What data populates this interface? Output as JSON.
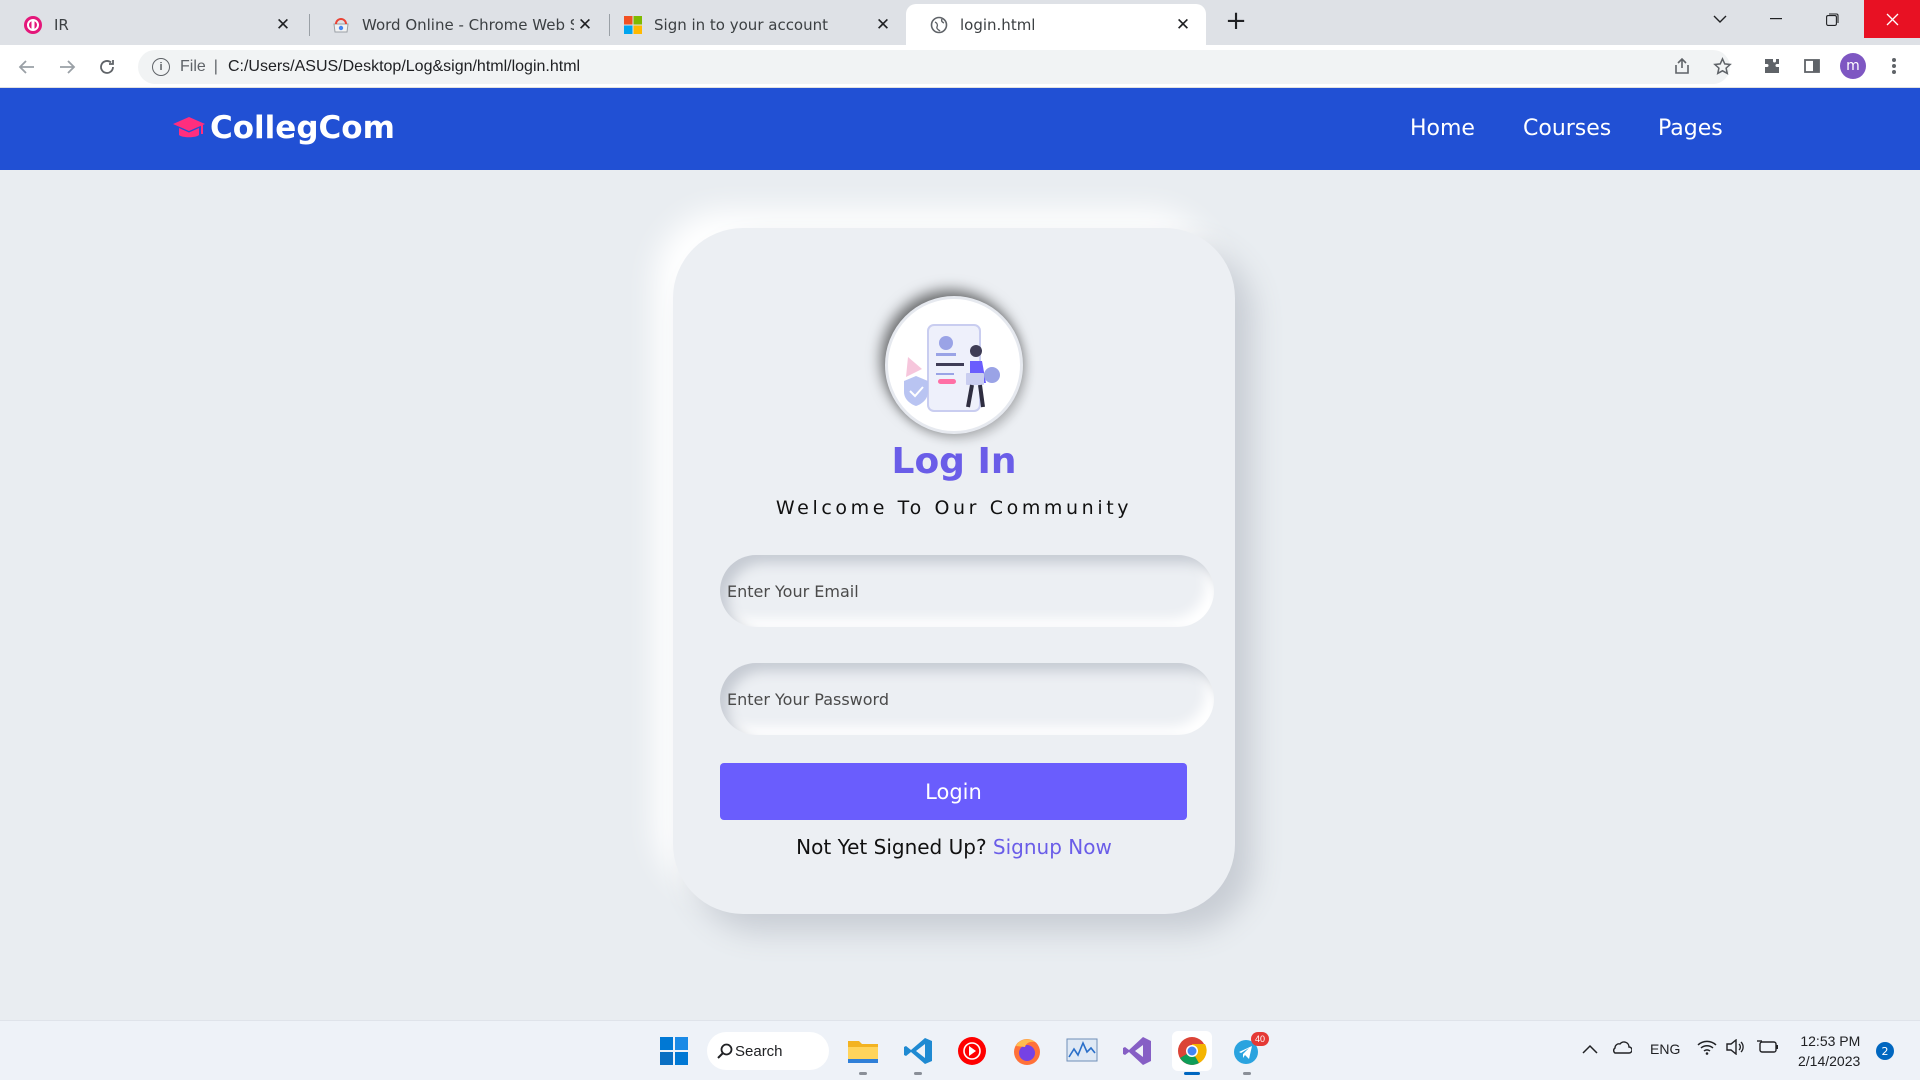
{
  "browser": {
    "tabs": [
      {
        "title": "IR",
        "icon": "ir-app-icon"
      },
      {
        "title": "Word Online - Chrome Web Store",
        "icon": "chrome-web-store-icon"
      },
      {
        "title": "Sign in to your account",
        "icon": "microsoft-logo-icon"
      },
      {
        "title": "login.html",
        "icon": "globe-icon",
        "active": true
      }
    ],
    "address": {
      "scheme_label": "File",
      "url": "C:/Users/ASUS/Desktop/Log&sign/html/login.html"
    },
    "profile_initial": "m"
  },
  "site": {
    "brand": "CollegCom",
    "nav": [
      "Home",
      "Courses",
      "Pages"
    ],
    "colors": {
      "header": "#2150d4",
      "accent": "#6a5dfd",
      "brand_icon": "#ff2e7e"
    }
  },
  "login": {
    "title": "Log In",
    "subtitle": "Welcome To Our Community",
    "email_placeholder": "Enter Your Email",
    "password_placeholder": "Enter Your Password",
    "button_label": "Login",
    "signup_prompt": "Not Yet Signed Up?",
    "signup_link": "Signup Now"
  },
  "taskbar": {
    "search_label": "Search",
    "apps": [
      "start-icon",
      "file-explorer-icon",
      "vscode-icon",
      "youtube-music-icon",
      "firefox-icon",
      "resource-monitor-icon",
      "visual-studio-icon",
      "chrome-icon",
      "telegram-icon"
    ],
    "telegram_badge": "40",
    "language": "ENG",
    "time": "12:53 PM",
    "date": "2/14/2023",
    "notification_count": "2"
  }
}
